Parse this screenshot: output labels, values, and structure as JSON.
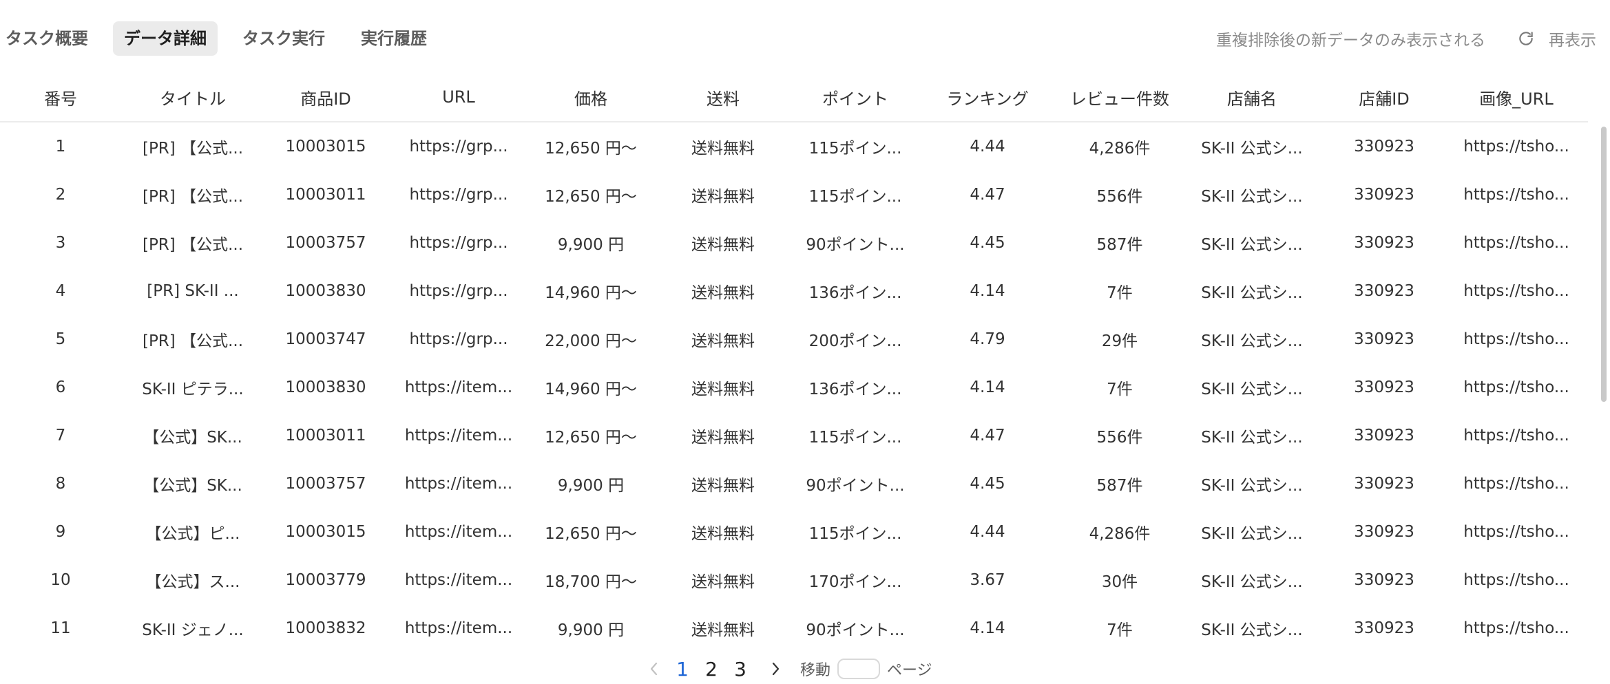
{
  "tabs": [
    {
      "label": "タスク概要",
      "active": false
    },
    {
      "label": "データ詳細",
      "active": true
    },
    {
      "label": "タスク実行",
      "active": false
    },
    {
      "label": "実行履歴",
      "active": false
    }
  ],
  "toolbar": {
    "dedup_note": "重複排除後の新データのみ表示される",
    "refresh_label": "再表示",
    "refresh_icon": "refresh-icon"
  },
  "table": {
    "columns": [
      "番号",
      "タイトル",
      "商品ID",
      "URL",
      "価格",
      "送料",
      "ポイント",
      "ランキング",
      "レビュー件数",
      "店舗名",
      "店舗ID",
      "画像_URL"
    ],
    "rows": [
      [
        "1",
        "[PR] 【公式...",
        "10003015",
        "https://grp...",
        "12,650 円〜",
        "送料無料",
        "115ポイン...",
        "4.44",
        "4,286件",
        "SK-II 公式シ...",
        "330923",
        "https://tsho..."
      ],
      [
        "2",
        "[PR] 【公式...",
        "10003011",
        "https://grp...",
        "12,650 円〜",
        "送料無料",
        "115ポイン...",
        "4.47",
        "556件",
        "SK-II 公式シ...",
        "330923",
        "https://tsho..."
      ],
      [
        "3",
        "[PR] 【公式...",
        "10003757",
        "https://grp...",
        "9,900 円",
        "送料無料",
        "90ポイント...",
        "4.45",
        "587件",
        "SK-II 公式シ...",
        "330923",
        "https://tsho..."
      ],
      [
        "4",
        "[PR] SK-II ...",
        "10003830",
        "https://grp...",
        "14,960 円〜",
        "送料無料",
        "136ポイン...",
        "4.14",
        "7件",
        "SK-II 公式シ...",
        "330923",
        "https://tsho..."
      ],
      [
        "5",
        "[PR] 【公式...",
        "10003747",
        "https://grp...",
        "22,000 円〜",
        "送料無料",
        "200ポイン...",
        "4.79",
        "29件",
        "SK-II 公式シ...",
        "330923",
        "https://tsho..."
      ],
      [
        "6",
        "SK-II ピテラ...",
        "10003830",
        "https://item...",
        "14,960 円〜",
        "送料無料",
        "136ポイン...",
        "4.14",
        "7件",
        "SK-II 公式シ...",
        "330923",
        "https://tsho..."
      ],
      [
        "7",
        "【公式】SK...",
        "10003011",
        "https://item...",
        "12,650 円〜",
        "送料無料",
        "115ポイン...",
        "4.47",
        "556件",
        "SK-II 公式シ...",
        "330923",
        "https://tsho..."
      ],
      [
        "8",
        "【公式】SK...",
        "10003757",
        "https://item...",
        "9,900 円",
        "送料無料",
        "90ポイント...",
        "4.45",
        "587件",
        "SK-II 公式シ...",
        "330923",
        "https://tsho..."
      ],
      [
        "9",
        "【公式】ピ...",
        "10003015",
        "https://item...",
        "12,650 円〜",
        "送料無料",
        "115ポイン...",
        "4.44",
        "4,286件",
        "SK-II 公式シ...",
        "330923",
        "https://tsho..."
      ],
      [
        "10",
        "【公式】ス...",
        "10003779",
        "https://item...",
        "18,700 円〜",
        "送料無料",
        "170ポイン...",
        "3.67",
        "30件",
        "SK-II 公式シ...",
        "330923",
        "https://tsho..."
      ],
      [
        "11",
        "SK-II ジェノ...",
        "10003832",
        "https://item...",
        "9,900 円",
        "送料無料",
        "90ポイント...",
        "4.14",
        "7件",
        "SK-II 公式シ...",
        "330923",
        "https://tsho..."
      ]
    ]
  },
  "pagination": {
    "prev_icon": "chevron-left-icon",
    "next_icon": "chevron-right-icon",
    "pages": [
      "1",
      "2",
      "3"
    ],
    "current_page": "1",
    "goto_label": "移動",
    "goto_value": "",
    "page_suffix": "ページ"
  },
  "colors": {
    "accent": "#1e66d6",
    "active_tab_bg": "#ebebeb",
    "muted_text": "#8a8a8a"
  }
}
